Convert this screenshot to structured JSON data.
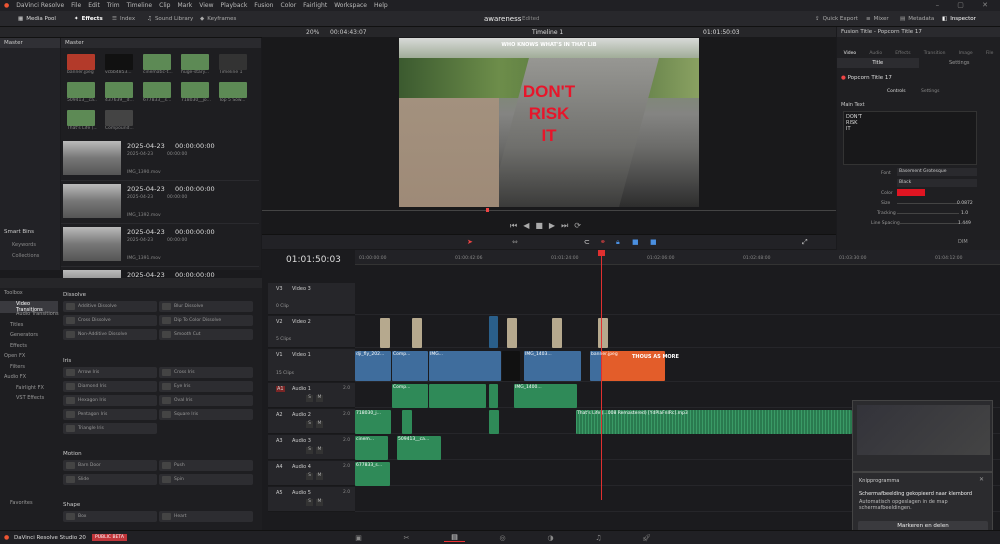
{
  "menubar": {
    "app": "DaVinci Resolve",
    "items": [
      "File",
      "Edit",
      "Trim",
      "Timeline",
      "Clip",
      "Mark",
      "View",
      "Playback",
      "Fusion",
      "Color",
      "Fairlight",
      "Workspace",
      "Help"
    ]
  },
  "toolbar": {
    "media_pool": "Media Pool",
    "effects": "Effects",
    "index": "Index",
    "sound_library": "Sound Library",
    "keyframes": "Keyframes",
    "project": "awareness",
    "edited": "Edited",
    "quick_export": "Quick Export",
    "mixer": "Mixer",
    "metadata": "Metadata",
    "inspector": "Inspector"
  },
  "viewer": {
    "zoom": "20%",
    "duration": "00:04:43:07",
    "timeline_name": "Timeline 1",
    "timecode": "01:01:50:03",
    "overlay_top": "WHO KNOWS WHAT'S IN THAT LIB",
    "overlay_main": [
      "DON'T",
      "RISK",
      "IT"
    ]
  },
  "mediapool": {
    "master": "Master",
    "bin_title": "Master",
    "thumbs": [
      {
        "name": "banner.jpeg",
        "color": "#b33a2a"
      },
      {
        "name": "vcbb4853...",
        "color": "#111"
      },
      {
        "name": "cinematic-t...",
        "color": "#5d8a55"
      },
      {
        "name": "huge-stary...",
        "color": "#5d8a55"
      },
      {
        "name": "Timeline 1",
        "color": "#333"
      },
      {
        "name": "509413__ca...",
        "color": "#5d8a55"
      },
      {
        "name": "437639__d...",
        "color": "#5d8a55"
      },
      {
        "name": "677833__s...",
        "color": "#5d8a55"
      },
      {
        "name": "718030__jo...",
        "color": "#5d8a55"
      },
      {
        "name": "Top 5 Sow...",
        "color": "#5d8a55"
      },
      {
        "name": "That's Life (...",
        "color": "#5d8a55"
      },
      {
        "name": "Compound...",
        "color": "#444"
      }
    ],
    "list": [
      {
        "date": "2025-04-23",
        "tc": "00:00:00:00",
        "date2": "2025-04-23",
        "tc2": "00:00:00",
        "file": "IMG_1390.mov"
      },
      {
        "date": "2025-04-23",
        "tc": "00:00:00:00",
        "date2": "2025-04-23",
        "tc2": "00:00:00",
        "file": "IMG_1392.mov"
      },
      {
        "date": "2025-04-23",
        "tc": "00:00:00:00",
        "date2": "2025-04-23",
        "tc2": "00:00:00",
        "file": "IMG_1391.mov"
      },
      {
        "date": "2025-04-23",
        "tc": "00:00:00:00",
        "date2": "",
        "tc2": "",
        "file": ""
      }
    ],
    "smart_bins": "Smart Bins",
    "keywords": "Keywords",
    "collections": "Collections"
  },
  "effects": {
    "tree": [
      "Toolbox",
      "Video Transitions",
      "Audio Transitions",
      "Titles",
      "Generators",
      "Effects",
      "Open FX",
      "Filters",
      "Audio FX",
      "Fairlight FX",
      "VST Effects",
      "Favorites"
    ],
    "dissolve": "Dissolve",
    "dissolve_items": [
      "Additive Dissolve",
      "Blur Dissolve",
      "Cross Dissolve",
      "Dip To Color Dissolve",
      "Non-Additive Dissolve",
      "Smooth Cut"
    ],
    "iris": "Iris",
    "iris_items": [
      "Arrow Iris",
      "Cross Iris",
      "Diamond Iris",
      "Eye Iris",
      "Hexagon Iris",
      "Oval Iris",
      "Pentagon Iris",
      "Square Iris",
      "Triangle Iris"
    ],
    "motion": "Motion",
    "motion_items": [
      "Barn Door",
      "Push",
      "Slide",
      "Spin"
    ],
    "shape": "Shape",
    "shape_items": [
      "Box",
      "Heart"
    ]
  },
  "timeline": {
    "timecode": "01:01:50:03",
    "ruler": [
      "01:00:00:00",
      "01:00:42:06",
      "01:01:24:00",
      "01:02:06:00",
      "01:02:48:00",
      "01:03:30:00",
      "01:04:12:00"
    ],
    "tracks": [
      {
        "id": "V3",
        "name": "Video 3",
        "clips": "0 Clip"
      },
      {
        "id": "V2",
        "name": "Video 2",
        "clips": "5 Clips"
      },
      {
        "id": "V1",
        "name": "Video 1",
        "clips": "15 Clips"
      },
      {
        "id": "A1",
        "name": "Audio 1",
        "vol": "2.0"
      },
      {
        "id": "A2",
        "name": "Audio 2",
        "vol": "2.0"
      },
      {
        "id": "A3",
        "name": "Audio 3",
        "vol": "2.0"
      },
      {
        "id": "A4",
        "name": "Audio 4",
        "vol": "2.0"
      },
      {
        "id": "A5",
        "name": "Audio 5",
        "vol": "2.0"
      }
    ],
    "clip_labels": {
      "v1a": "dji_fly_202...",
      "v1b": "Comp...",
      "v1c": "IMG...",
      "v1d": "IMG_1403...",
      "v1e": "banner.jpeg",
      "a1a": "Comp...",
      "a1b": "IMG_1400...",
      "a2a": "718030_j...",
      "a2b": "That's Life (...008 Remastered) [YdPlaFnIRc].mp3",
      "a3a": "509413__ca...",
      "a3b": "cinem...",
      "a4a": "677833_s..."
    },
    "banner_text": "THOUS AS MORE",
    "solo": "S",
    "mute": "M",
    "dim": "DIM"
  },
  "inspector": {
    "title": "Fusion Title - Popcorn Title 17",
    "tabs": [
      "Video",
      "Audio",
      "Effects",
      "Transition",
      "Image",
      "File"
    ],
    "subtabs": [
      "Title",
      "Settings"
    ],
    "clip": "Popcorn Title 17",
    "ctrl_tabs": [
      "Controls",
      "Settings"
    ],
    "section": "Main Text",
    "text": "DON'T\nRISK\nIT",
    "font_label": "Font",
    "font_value": "Basement Grotesque",
    "style_value": "Black",
    "color_label": "Color",
    "color": "#e01522",
    "size_label": "Size",
    "size_value": "0.0872",
    "tracking_label": "Tracking",
    "tracking_value": "1.0",
    "spacing_label": "Line Spacing",
    "spacing_value": "1.449"
  },
  "notification": {
    "app": "Knipprogramma",
    "title": "Schermafbeelding gekopieerd naar klembord",
    "body": "Automatisch opgeslagen in de map schermafbeeldingen.",
    "button": "Markeren en delen"
  },
  "footer": {
    "app": "DaVinci Resolve Studio 20",
    "badge": "PUBLIC BETA"
  }
}
